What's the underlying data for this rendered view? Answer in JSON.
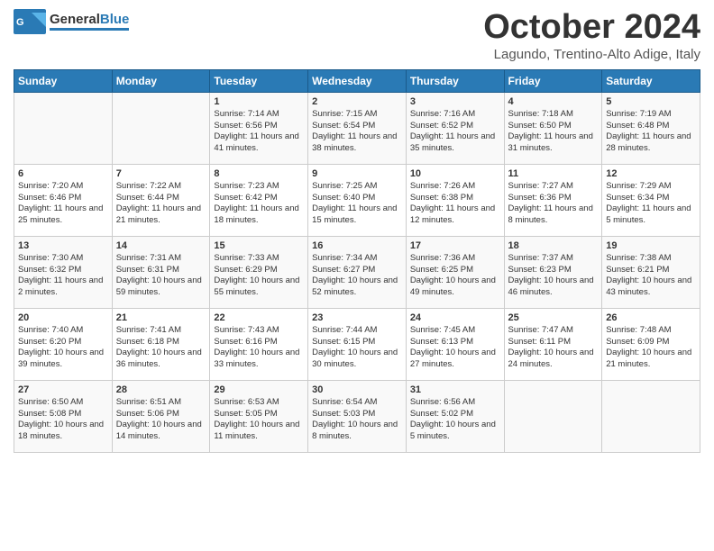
{
  "header": {
    "logo_general": "General",
    "logo_blue": "Blue",
    "month": "October 2024",
    "location": "Lagundo, Trentino-Alto Adige, Italy"
  },
  "days_of_week": [
    "Sunday",
    "Monday",
    "Tuesday",
    "Wednesday",
    "Thursday",
    "Friday",
    "Saturday"
  ],
  "weeks": [
    [
      {
        "day": "",
        "info": ""
      },
      {
        "day": "",
        "info": ""
      },
      {
        "day": "1",
        "info": "Sunrise: 7:14 AM\nSunset: 6:56 PM\nDaylight: 11 hours and 41 minutes."
      },
      {
        "day": "2",
        "info": "Sunrise: 7:15 AM\nSunset: 6:54 PM\nDaylight: 11 hours and 38 minutes."
      },
      {
        "day": "3",
        "info": "Sunrise: 7:16 AM\nSunset: 6:52 PM\nDaylight: 11 hours and 35 minutes."
      },
      {
        "day": "4",
        "info": "Sunrise: 7:18 AM\nSunset: 6:50 PM\nDaylight: 11 hours and 31 minutes."
      },
      {
        "day": "5",
        "info": "Sunrise: 7:19 AM\nSunset: 6:48 PM\nDaylight: 11 hours and 28 minutes."
      }
    ],
    [
      {
        "day": "6",
        "info": "Sunrise: 7:20 AM\nSunset: 6:46 PM\nDaylight: 11 hours and 25 minutes."
      },
      {
        "day": "7",
        "info": "Sunrise: 7:22 AM\nSunset: 6:44 PM\nDaylight: 11 hours and 21 minutes."
      },
      {
        "day": "8",
        "info": "Sunrise: 7:23 AM\nSunset: 6:42 PM\nDaylight: 11 hours and 18 minutes."
      },
      {
        "day": "9",
        "info": "Sunrise: 7:25 AM\nSunset: 6:40 PM\nDaylight: 11 hours and 15 minutes."
      },
      {
        "day": "10",
        "info": "Sunrise: 7:26 AM\nSunset: 6:38 PM\nDaylight: 11 hours and 12 minutes."
      },
      {
        "day": "11",
        "info": "Sunrise: 7:27 AM\nSunset: 6:36 PM\nDaylight: 11 hours and 8 minutes."
      },
      {
        "day": "12",
        "info": "Sunrise: 7:29 AM\nSunset: 6:34 PM\nDaylight: 11 hours and 5 minutes."
      }
    ],
    [
      {
        "day": "13",
        "info": "Sunrise: 7:30 AM\nSunset: 6:32 PM\nDaylight: 11 hours and 2 minutes."
      },
      {
        "day": "14",
        "info": "Sunrise: 7:31 AM\nSunset: 6:31 PM\nDaylight: 10 hours and 59 minutes."
      },
      {
        "day": "15",
        "info": "Sunrise: 7:33 AM\nSunset: 6:29 PM\nDaylight: 10 hours and 55 minutes."
      },
      {
        "day": "16",
        "info": "Sunrise: 7:34 AM\nSunset: 6:27 PM\nDaylight: 10 hours and 52 minutes."
      },
      {
        "day": "17",
        "info": "Sunrise: 7:36 AM\nSunset: 6:25 PM\nDaylight: 10 hours and 49 minutes."
      },
      {
        "day": "18",
        "info": "Sunrise: 7:37 AM\nSunset: 6:23 PM\nDaylight: 10 hours and 46 minutes."
      },
      {
        "day": "19",
        "info": "Sunrise: 7:38 AM\nSunset: 6:21 PM\nDaylight: 10 hours and 43 minutes."
      }
    ],
    [
      {
        "day": "20",
        "info": "Sunrise: 7:40 AM\nSunset: 6:20 PM\nDaylight: 10 hours and 39 minutes."
      },
      {
        "day": "21",
        "info": "Sunrise: 7:41 AM\nSunset: 6:18 PM\nDaylight: 10 hours and 36 minutes."
      },
      {
        "day": "22",
        "info": "Sunrise: 7:43 AM\nSunset: 6:16 PM\nDaylight: 10 hours and 33 minutes."
      },
      {
        "day": "23",
        "info": "Sunrise: 7:44 AM\nSunset: 6:15 PM\nDaylight: 10 hours and 30 minutes."
      },
      {
        "day": "24",
        "info": "Sunrise: 7:45 AM\nSunset: 6:13 PM\nDaylight: 10 hours and 27 minutes."
      },
      {
        "day": "25",
        "info": "Sunrise: 7:47 AM\nSunset: 6:11 PM\nDaylight: 10 hours and 24 minutes."
      },
      {
        "day": "26",
        "info": "Sunrise: 7:48 AM\nSunset: 6:09 PM\nDaylight: 10 hours and 21 minutes."
      }
    ],
    [
      {
        "day": "27",
        "info": "Sunrise: 6:50 AM\nSunset: 5:08 PM\nDaylight: 10 hours and 18 minutes."
      },
      {
        "day": "28",
        "info": "Sunrise: 6:51 AM\nSunset: 5:06 PM\nDaylight: 10 hours and 14 minutes."
      },
      {
        "day": "29",
        "info": "Sunrise: 6:53 AM\nSunset: 5:05 PM\nDaylight: 10 hours and 11 minutes."
      },
      {
        "day": "30",
        "info": "Sunrise: 6:54 AM\nSunset: 5:03 PM\nDaylight: 10 hours and 8 minutes."
      },
      {
        "day": "31",
        "info": "Sunrise: 6:56 AM\nSunset: 5:02 PM\nDaylight: 10 hours and 5 minutes."
      },
      {
        "day": "",
        "info": ""
      },
      {
        "day": "",
        "info": ""
      }
    ]
  ]
}
